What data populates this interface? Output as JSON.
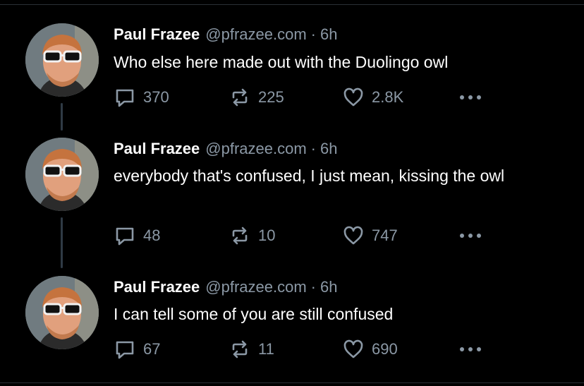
{
  "posts": [
    {
      "author_name": "Paul Frazee",
      "handle": "@pfrazee.com",
      "separator": "·",
      "time": "6h",
      "text": "Who else here made out with the Duolingo owl",
      "replies": "370",
      "reposts": "225",
      "likes": "2.8K"
    },
    {
      "author_name": "Paul Frazee",
      "handle": "@pfrazee.com",
      "separator": "·",
      "time": "6h",
      "text": "everybody that's confused, I just mean, kissing the owl",
      "replies": "48",
      "reposts": "10",
      "likes": "747"
    },
    {
      "author_name": "Paul Frazee",
      "handle": "@pfrazee.com",
      "separator": "·",
      "time": "6h",
      "text": "I can tell some of you are still confused",
      "replies": "67",
      "reposts": "11",
      "likes": "690"
    }
  ],
  "icons": {
    "reply": "reply-icon",
    "repost": "repost-icon",
    "like": "heart-icon",
    "more": "more-icon"
  },
  "colors": {
    "background": "#000000",
    "text_primary": "#ffffff",
    "text_secondary": "#8b98a5",
    "thread_line": "#2f3a45"
  }
}
